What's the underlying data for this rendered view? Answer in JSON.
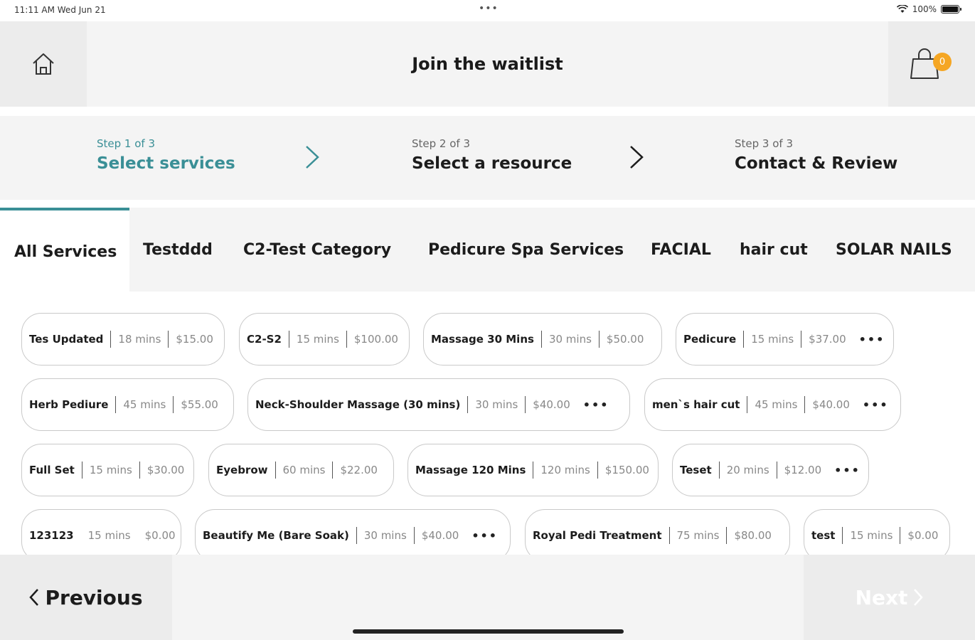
{
  "status_bar": {
    "time": "11:11 AM   Wed Jun 21",
    "dots": "•••",
    "battery": "100%"
  },
  "header": {
    "title": "Join the waitlist",
    "home_icon": "home-icon",
    "cart_icon": "shopping-bag-icon",
    "cart_count": "0"
  },
  "colors": {
    "accent": "#3a8f96",
    "badge": "#f5a623",
    "panel": "#f4f4f4"
  },
  "steps": [
    {
      "num": "Step 1 of 3",
      "label": "Select services",
      "active": true
    },
    {
      "num": "Step 2 of 3",
      "label": "Select a resource",
      "active": false
    },
    {
      "num": "Step 3 of 3",
      "label": "Contact & Review",
      "active": false
    }
  ],
  "tabs": [
    {
      "label": "All Services",
      "active": true
    },
    {
      "label": "Testddd"
    },
    {
      "label": "C2-Test Category"
    },
    {
      "label": "Pedicure Spa Services"
    },
    {
      "label": "FACIAL"
    },
    {
      "label": "hair cut"
    },
    {
      "label": "SOLAR NAILS"
    }
  ],
  "services": [
    {
      "name": "Tes Updated",
      "duration": "18 mins",
      "price": "$15.00",
      "more": ""
    },
    {
      "name": "C2-S2",
      "duration": "15 mins",
      "price": "$100.00",
      "more": ""
    },
    {
      "name": "Massage 30 Mins",
      "duration": "30 mins",
      "price": "$50.00",
      "more": ""
    },
    {
      "name": "Pedicure",
      "duration": "15 mins",
      "price": "$37.00",
      "more": "•••"
    },
    {
      "name": "Herb Pediure",
      "duration": "45 mins",
      "price": "$55.00",
      "more": ""
    },
    {
      "name": "Neck-Shoulder Massage (30 mins)",
      "duration": "30 mins",
      "price": "$40.00",
      "more": "•••"
    },
    {
      "name": "men`s hair cut",
      "duration": "45 mins",
      "price": "$40.00",
      "more": "•••"
    },
    {
      "name": "Full Set",
      "duration": "15 mins",
      "price": "$30.00",
      "more": ""
    },
    {
      "name": "Eyebrow",
      "duration": "60 mins",
      "price": "$22.00",
      "more": ""
    },
    {
      "name": "Massage 120 Mins",
      "duration": "120 mins",
      "price": "$150.00",
      "more": ""
    },
    {
      "name": "Teset",
      "duration": "20 mins",
      "price": "$12.00",
      "more": "•••"
    },
    {
      "name": "123123",
      "duration": "15 mins",
      "price": "$0.00",
      "more": ""
    },
    {
      "name": "Beautify Me (Bare Soak)",
      "duration": "30 mins",
      "price": "$40.00",
      "more": "•••"
    },
    {
      "name": "Royal Pedi Treatment",
      "duration": "75 mins",
      "price": "$80.00",
      "more": ""
    },
    {
      "name": "test",
      "duration": "15 mins",
      "price": "$0.00",
      "more": ""
    }
  ],
  "footer": {
    "previous_label": "Previous",
    "next_label": "Next"
  }
}
